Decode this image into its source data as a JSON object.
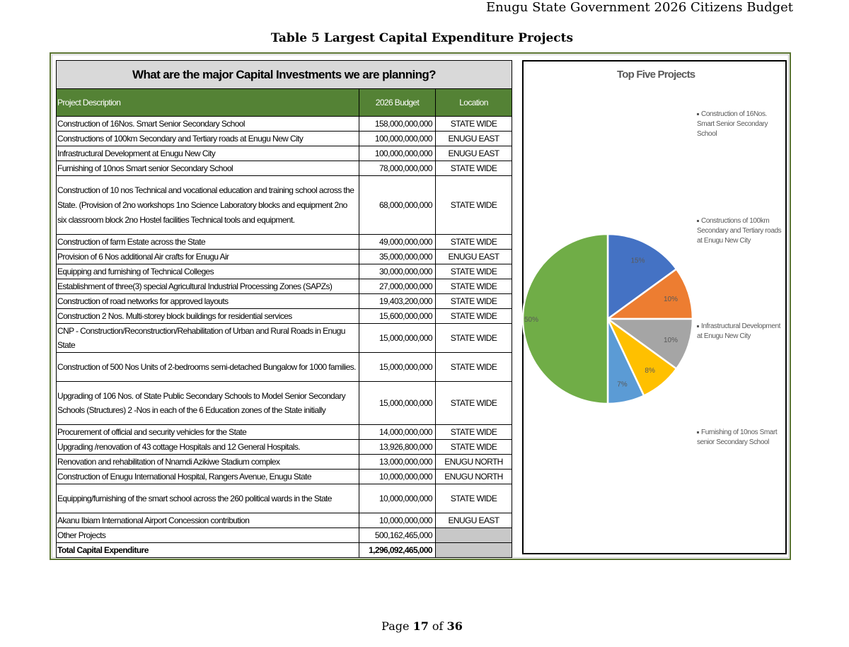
{
  "header": {
    "text": "Enugu State Government 2026 Citizens Budget"
  },
  "document_title": "Table 5 Largest Capital Expenditure Projects",
  "table": {
    "banner": "What are the major Capital Investments we are planning?",
    "columns": [
      "Project Description",
      "2026 Budget",
      "Location"
    ],
    "rows": [
      {
        "description": "Construction of 16Nos. Smart Senior Secondary School",
        "budget": "158,000,000,000",
        "location": "STATE WIDE"
      },
      {
        "description": "Constructions of 100km Secondary and Tertiary roads at Enugu New City",
        "budget": "100,000,000,000",
        "location": "ENUGU EAST"
      },
      {
        "description": "Infrastructural Development at Enugu New City",
        "budget": "100,000,000,000",
        "location": "ENUGU EAST"
      },
      {
        "description": "Furnishing of 10nos Smart senior Secondary School",
        "budget": "78,000,000,000",
        "location": "STATE WIDE"
      },
      {
        "description": "Construction of  10 nos Technical and vocational education and training school across the State.  (Provision of 2no workshops  1no Science Laboratory blocks and equipment  2no six classroom block  2no Hostel facilities  Technical tools and equipment.",
        "budget": "68,000,000,000",
        "location": "STATE WIDE"
      },
      {
        "description": "Construction of farm Estate across the State",
        "budget": "49,000,000,000",
        "location": "STATE WIDE"
      },
      {
        "description": "Provision of 6 Nos additional Air crafts for Enugu Air",
        "budget": "35,000,000,000",
        "location": "ENUGU EAST"
      },
      {
        "description": "Equipping and furnishing of  Technical Colleges",
        "budget": "30,000,000,000",
        "location": "STATE WIDE"
      },
      {
        "description": "Establishment of three(3) special Agricultural Industrial Processing Zones (SAPZs)",
        "budget": "27,000,000,000",
        "location": "STATE WIDE"
      },
      {
        "description": "Construction of road networks for approved layouts",
        "budget": "19,403,200,000",
        "location": "STATE WIDE"
      },
      {
        "description": "Construction 2 Nos. Multi-storey block buildings for residential services",
        "budget": "15,600,000,000",
        "location": "STATE WIDE"
      },
      {
        "description": "CNP - Construction/Reconstruction/Rehabilitation of Urban and Rural Roads in Enugu State",
        "budget": "15,000,000,000",
        "location": "STATE WIDE"
      },
      {
        "description": "Construction of 500 Nos Units of 2-bedrooms semi-detached Bungalow for 1000 families.",
        "budget": "15,000,000,000",
        "location": "STATE WIDE"
      },
      {
        "description": "Upgrading of 106 Nos. of State Public Secondary Schools to Model Senior Secondary Schools (Structures) 2 -Nos in each of the 6 Education zones of the State initially",
        "budget": "15,000,000,000",
        "location": "STATE WIDE"
      },
      {
        "description": "Procurement of official and security vehicles for the State",
        "budget": "14,000,000,000",
        "location": "STATE WIDE"
      },
      {
        "description": "Upgrading /renovation of 43 cottage Hospitals and 12 General Hospitals.",
        "budget": "13,926,800,000",
        "location": "STATE WIDE"
      },
      {
        "description": "Renovation and rehabilitation of Nnamdi Azikiwe Stadium complex",
        "budget": "13,000,000,000",
        "location": "ENUGU NORTH"
      },
      {
        "description": "Construction of Enugu International Hospital, Rangers Avenue, Enugu State",
        "budget": "10,000,000,000",
        "location": "ENUGU NORTH"
      },
      {
        "description": "Equipping/furnishing  of  the  smart  school  across  the  260  political wards in the State",
        "budget": "10,000,000,000",
        "location": "STATE WIDE"
      },
      {
        "description": "Akanu Ibiam International Airport Concession contribution",
        "budget": "10,000,000,000",
        "location": "ENUGU EAST"
      }
    ],
    "other": {
      "description": "Other Projects",
      "budget": "500,162,465,000"
    },
    "total": {
      "description": "Total Capital Expenditure",
      "budget": "1,296,092,465,000"
    }
  },
  "chart_data": {
    "type": "pie",
    "title": "Top Five Projects",
    "slices": [
      {
        "label": "15%",
        "value": 15,
        "color": "#4472c4"
      },
      {
        "label": "10%",
        "value": 10,
        "color": "#ed7d31"
      },
      {
        "label": "10%",
        "value": 10,
        "color": "#a5a5a5"
      },
      {
        "label": "8%",
        "value": 8,
        "color": "#ffc000"
      },
      {
        "label": "7%",
        "value": 7,
        "color": "#5b9bd5"
      },
      {
        "label": "50%",
        "value": 50,
        "color": "#70ad47"
      }
    ],
    "legend": [
      "Construction of 16Nos. Smart Senior Secondary School",
      "Constructions of 100km Secondary and Tertiary roads at Enugu New City",
      "Infrastructural Development at Enugu New City",
      "Furnishing of 10nos Smart senior Secondary School"
    ],
    "legend_position": "right"
  },
  "footer": {
    "prefix": "Page ",
    "page": "17",
    "middle": " of ",
    "total": "36"
  }
}
